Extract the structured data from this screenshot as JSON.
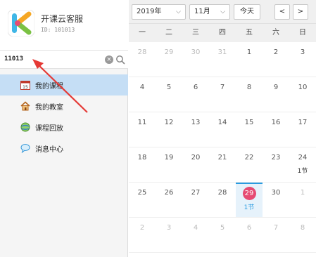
{
  "app": {
    "title": "开课云客服",
    "user_id": "ID: 101013"
  },
  "search": {
    "value": "11013"
  },
  "nav": {
    "items": [
      {
        "label": "我的课程",
        "icon": "calendar-icon",
        "active": true
      },
      {
        "label": "我的教室",
        "icon": "house-icon",
        "active": false
      },
      {
        "label": "课程回放",
        "icon": "playback-icon",
        "active": false
      },
      {
        "label": "消息中心",
        "icon": "message-icon",
        "active": false
      }
    ]
  },
  "calendar": {
    "year": "2019年",
    "month": "11月",
    "today_label": "今天",
    "prev": "<",
    "next": ">",
    "weekdays": [
      "一",
      "二",
      "三",
      "四",
      "五",
      "六",
      "日"
    ],
    "weeks": [
      [
        {
          "d": "28",
          "other": true
        },
        {
          "d": "29",
          "other": true
        },
        {
          "d": "30",
          "other": true
        },
        {
          "d": "31",
          "other": true
        },
        {
          "d": "1"
        },
        {
          "d": "2"
        },
        {
          "d": "3"
        }
      ],
      [
        {
          "d": "4"
        },
        {
          "d": "5"
        },
        {
          "d": "6"
        },
        {
          "d": "7"
        },
        {
          "d": "8"
        },
        {
          "d": "9"
        },
        {
          "d": "10"
        }
      ],
      [
        {
          "d": "11"
        },
        {
          "d": "12"
        },
        {
          "d": "13"
        },
        {
          "d": "14"
        },
        {
          "d": "15"
        },
        {
          "d": "16"
        },
        {
          "d": "17"
        }
      ],
      [
        {
          "d": "18"
        },
        {
          "d": "19"
        },
        {
          "d": "20"
        },
        {
          "d": "21"
        },
        {
          "d": "22"
        },
        {
          "d": "23"
        },
        {
          "d": "24",
          "lesson": "1节"
        }
      ],
      [
        {
          "d": "25"
        },
        {
          "d": "26"
        },
        {
          "d": "27"
        },
        {
          "d": "28"
        },
        {
          "d": "29",
          "today": true,
          "lesson": "1节"
        },
        {
          "d": "30"
        },
        {
          "d": "1",
          "other": true
        }
      ],
      [
        {
          "d": "2",
          "other": true
        },
        {
          "d": "3",
          "other": true
        },
        {
          "d": "4",
          "other": true
        },
        {
          "d": "5",
          "other": true
        },
        {
          "d": "6",
          "other": true
        },
        {
          "d": "7",
          "other": true
        },
        {
          "d": "8",
          "other": true
        }
      ]
    ]
  },
  "colors": {
    "active_nav": "#c5def5",
    "today_badge": "#e64b73",
    "today_accent": "#2a9be0",
    "arrow": "#e53935"
  }
}
